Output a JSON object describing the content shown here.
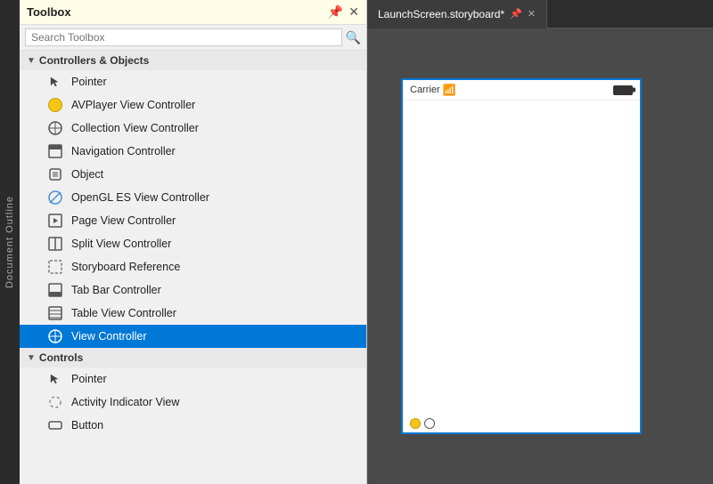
{
  "docOutline": {
    "label": "Document Outline"
  },
  "toolbox": {
    "title": "Toolbox",
    "searchPlaceholder": "Search Toolbox",
    "groups": [
      {
        "name": "Controllers & Objects",
        "expanded": true,
        "items": [
          {
            "id": "pointer",
            "label": "Pointer",
            "icon": "pointer"
          },
          {
            "id": "avplayer",
            "label": "AVPlayer View Controller",
            "icon": "yellow-circle"
          },
          {
            "id": "collection",
            "label": "Collection View Controller",
            "icon": "grid-circle"
          },
          {
            "id": "navigation",
            "label": "Navigation Controller",
            "icon": "nav"
          },
          {
            "id": "object",
            "label": "Object",
            "icon": "cube"
          },
          {
            "id": "opengl",
            "label": "OpenGL ES View Controller",
            "icon": "opengl"
          },
          {
            "id": "pageview",
            "label": "Page View Controller",
            "icon": "page"
          },
          {
            "id": "splitview",
            "label": "Split View Controller",
            "icon": "split"
          },
          {
            "id": "storyboard",
            "label": "Storyboard Reference",
            "icon": "storyboard"
          },
          {
            "id": "tabbar",
            "label": "Tab Bar Controller",
            "icon": "tabbar"
          },
          {
            "id": "tableview",
            "label": "Table View Controller",
            "icon": "tableview"
          },
          {
            "id": "viewcontroller",
            "label": "View Controller",
            "icon": "viewcontroller",
            "selected": true
          }
        ]
      },
      {
        "name": "Controls",
        "expanded": true,
        "items": [
          {
            "id": "pointer2",
            "label": "Pointer",
            "icon": "pointer"
          },
          {
            "id": "activity",
            "label": "Activity Indicator View",
            "icon": "activity"
          },
          {
            "id": "button",
            "label": "Button",
            "icon": "button"
          }
        ]
      }
    ]
  },
  "editor": {
    "tabs": [
      {
        "label": "LaunchScreen.storyboard*",
        "active": true,
        "hasPin": true,
        "hasClose": true
      }
    ]
  },
  "phone": {
    "carrier": "Carrier",
    "statusBarItems": [
      "Carrier",
      "WiFi",
      "Battery"
    ]
  }
}
